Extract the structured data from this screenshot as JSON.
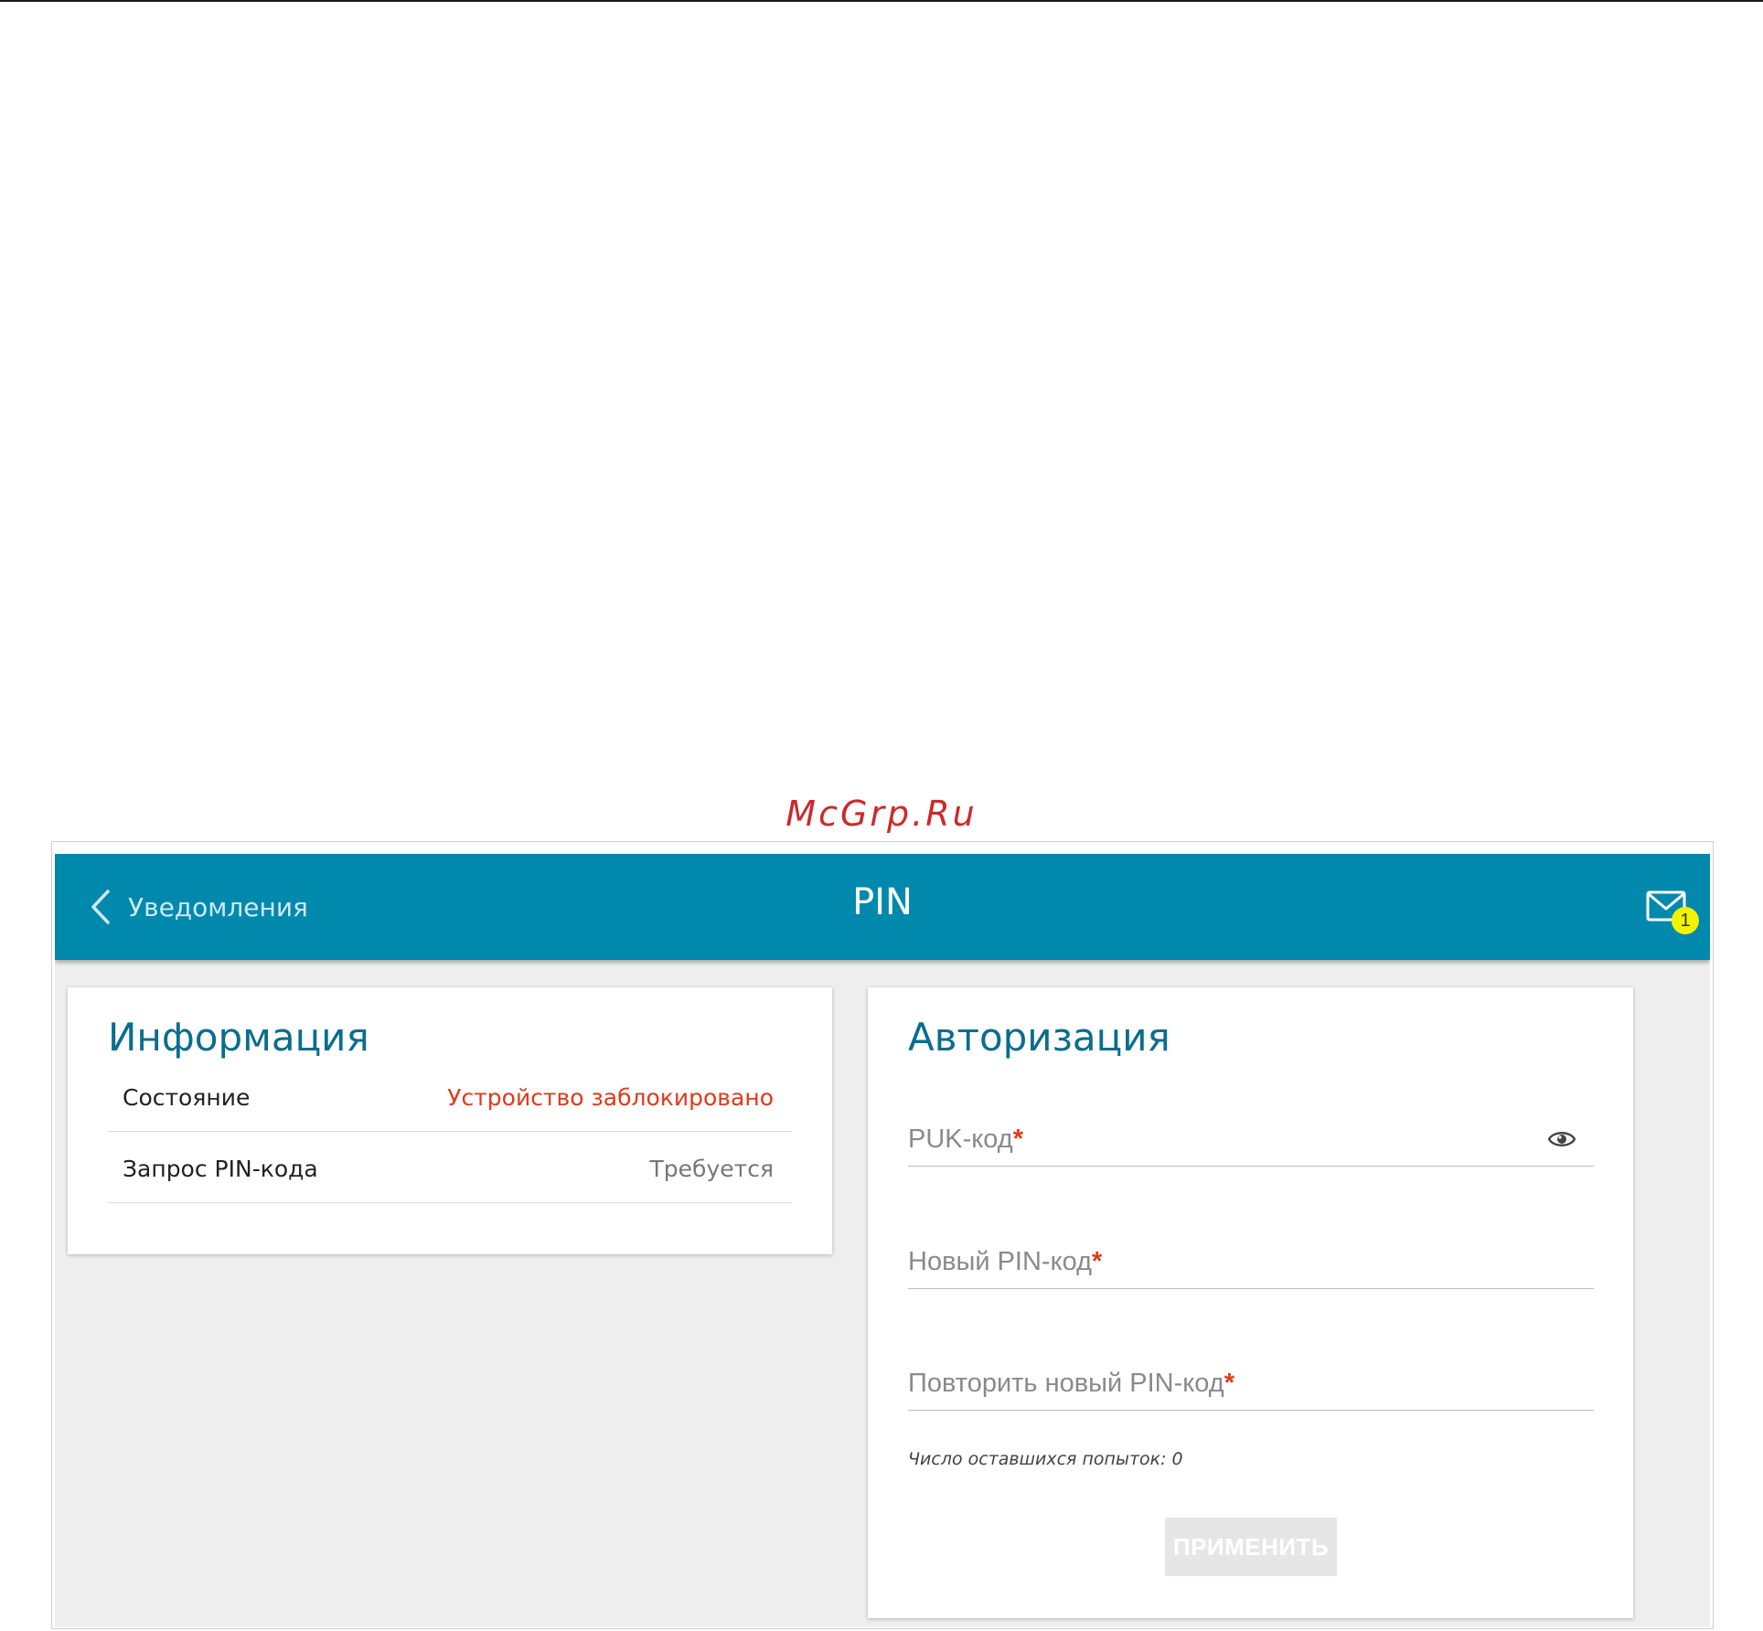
{
  "watermark": "McGrp.Ru",
  "header": {
    "back_label": "Уведомления",
    "title": "PIN",
    "notifications_count": "1"
  },
  "info_card": {
    "title": "Информация",
    "rows": [
      {
        "label": "Состояние",
        "value": "Устройство заблокировано"
      },
      {
        "label": "Запрос PIN-кода",
        "value": "Требуется"
      }
    ]
  },
  "auth_card": {
    "title": "Авторизация",
    "fields": [
      {
        "label": "PUK-код",
        "required_mark": "*",
        "value": ""
      },
      {
        "label": "Новый PIN-код",
        "required_mark": "*",
        "value": ""
      },
      {
        "label": "Повторить новый PIN-код",
        "required_mark": "*",
        "value": ""
      }
    ],
    "attempts_label": "Число оставшихся попыток:",
    "attempts_value": "0",
    "apply_label": "ПРИМЕНИТЬ"
  },
  "colors": {
    "header": "#0189ad",
    "title_text": "#0a6d8e",
    "alert": "#e2391b",
    "badge": "#f3f300",
    "watermark": "#cc2a2a"
  },
  "icons": {
    "back": "chevron-left-icon",
    "mail": "envelope-icon",
    "password_toggle": "eye-icon"
  }
}
